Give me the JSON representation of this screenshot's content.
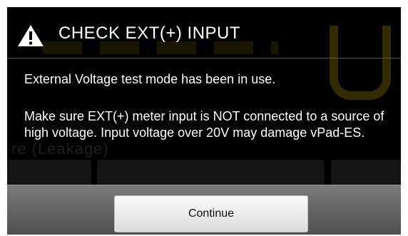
{
  "dialog": {
    "title": "CHECK  EXT(+)  INPUT",
    "title_icon": "warning-triangle-icon",
    "message_line1": "External Voltage test mode has been in use.",
    "message_line2": "Make sure EXT(+) meter input is NOT connected to a source of high voltage. Input voltage over 20V may damage vPad-ES.",
    "continue_label": "Continue"
  },
  "background": {
    "partial_text": "re                         (Leakage)"
  },
  "colors": {
    "dialog_bg": "#000000",
    "text": "#ffffff",
    "button_bar": "#6b6b6b",
    "button_bg": "#f0f0f0"
  }
}
